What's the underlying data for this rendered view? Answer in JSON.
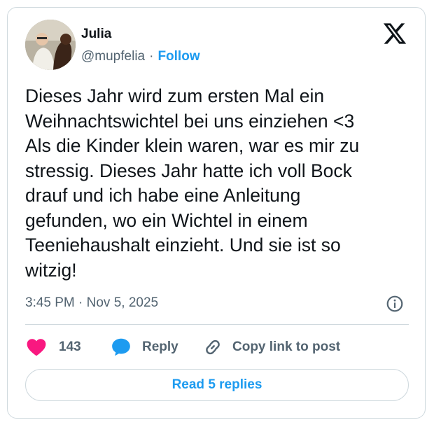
{
  "author": {
    "name": "Julia",
    "handle": "@mupfelia",
    "separator": "·",
    "follow_label": "Follow"
  },
  "logo_icon": "x-logo-icon",
  "tweet": {
    "lines": [
      "Dieses Jahr wird zum ersten Mal ein",
      "Weihnachtswichtel bei uns einziehen <3",
      "Als die Kinder klein waren, war es mir zu",
      "stressig. Dieses Jahr hatte ich voll Bock",
      "drauf und ich habe eine Anleitung",
      "gefunden, wo ein Wichtel in einem",
      "Teeniehaushalt einzieht. Und sie ist so",
      "witzig!"
    ],
    "timestamp": "3:45 PM · Nov 5, 2025"
  },
  "actions": {
    "likes": {
      "count": "143",
      "icon": "heart-icon"
    },
    "reply": {
      "label": "Reply",
      "icon": "speech-bubble-icon"
    },
    "copy": {
      "label": "Copy link to post",
      "icon": "link-icon"
    }
  },
  "read_replies_label": "Read 5 replies",
  "colors": {
    "accent": "#1d9bf0",
    "like": "#f91880",
    "text": "#0f1419",
    "secondary": "#536471",
    "border": "#cfd9de"
  }
}
